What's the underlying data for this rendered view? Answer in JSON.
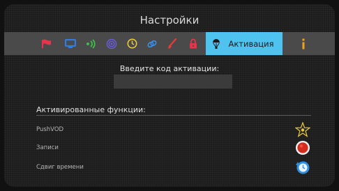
{
  "header": {
    "title": "Настройки"
  },
  "tabs": [
    {
      "name": "flag-icon",
      "color": "#e8334a"
    },
    {
      "name": "screen-icon",
      "color": "#2f7de1"
    },
    {
      "name": "sound-icon",
      "color": "#3ec04a"
    },
    {
      "name": "network-icon",
      "color": "#6a5cd6"
    },
    {
      "name": "clock-icon",
      "color": "#e8c93a"
    },
    {
      "name": "link-icon",
      "color": "#3a8fe8"
    },
    {
      "name": "brush-icon",
      "color": "#e83a3a"
    },
    {
      "name": "lock-icon",
      "color": "#e8334a"
    },
    {
      "name": "info-icon",
      "color": "#f0a020"
    }
  ],
  "active_tab": {
    "label": "Активация",
    "icon": "balloon-icon",
    "color": "#4ec3f0"
  },
  "activation": {
    "prompt": "Введите код активации:",
    "code_value": ""
  },
  "features": {
    "title": "Активированные функции:",
    "items": [
      {
        "label": "PushVOD",
        "icon": "star-icon"
      },
      {
        "label": "Записи",
        "icon": "record-icon"
      },
      {
        "label": "Сдвиг времени",
        "icon": "timeshift-icon"
      }
    ]
  }
}
